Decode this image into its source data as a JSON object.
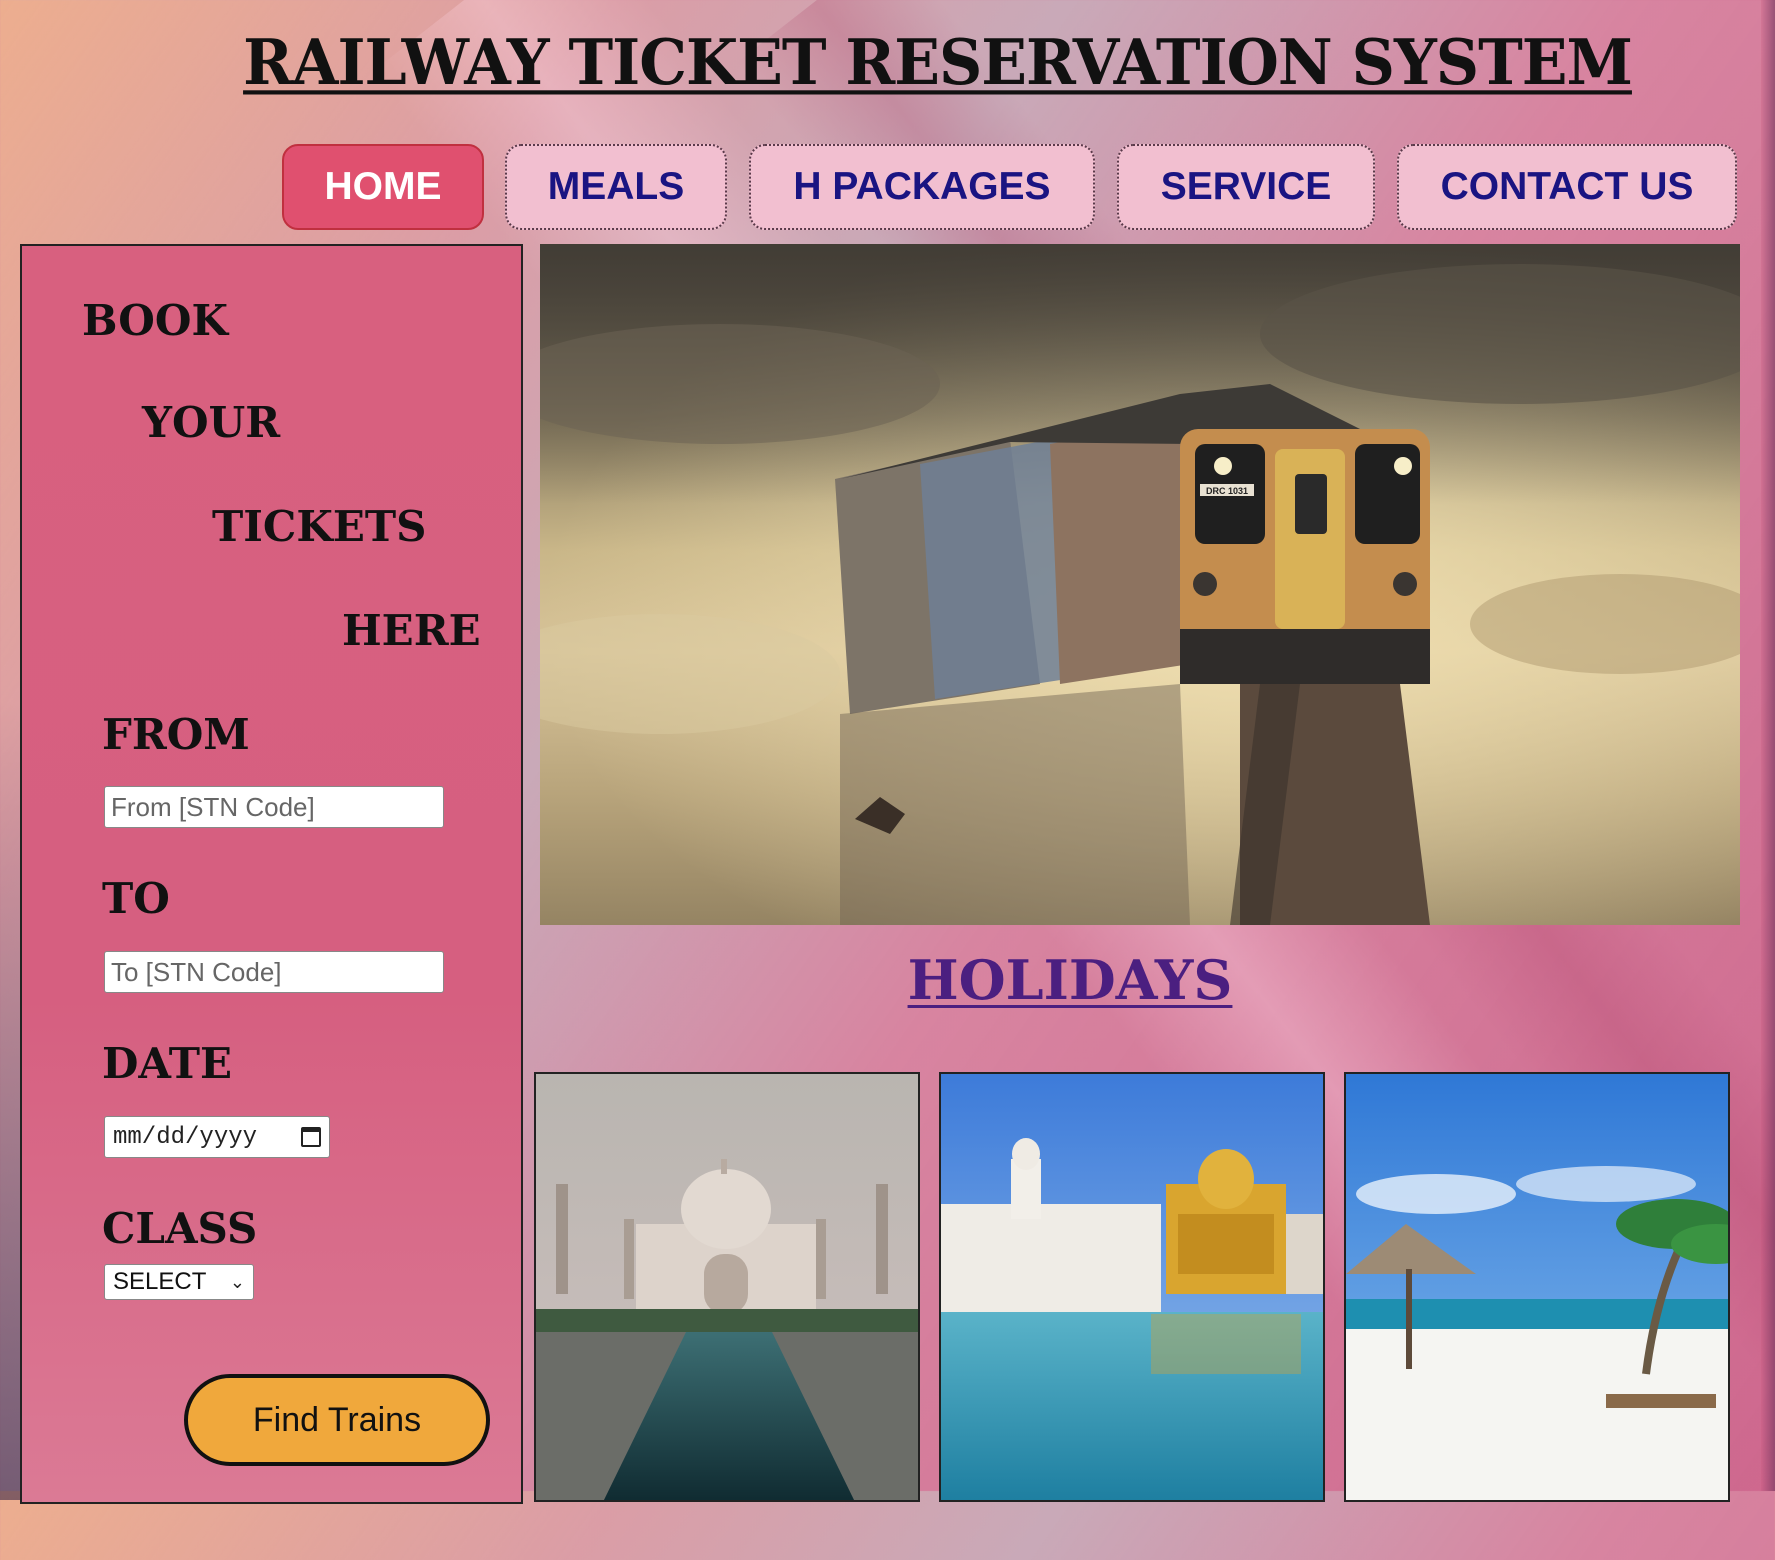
{
  "header": {
    "title": "RAILWAY TICKET RESERVATION SYSTEM"
  },
  "nav": {
    "items": [
      {
        "label": "HOME",
        "active": true
      },
      {
        "label": "MEALS",
        "active": false
      },
      {
        "label": "H PACKAGES",
        "active": false
      },
      {
        "label": "SERVICE",
        "active": false
      },
      {
        "label": "CONTACT US",
        "active": false
      }
    ]
  },
  "booking": {
    "heading_words": [
      "BOOK",
      "YOUR",
      "TICKETS",
      "HERE"
    ],
    "from_label": "FROM",
    "from_placeholder": "From [STN Code]",
    "to_label": "TO",
    "to_placeholder": "To [STN Code]",
    "date_label": "DATE",
    "date_placeholder": "mm/dd/yyyy",
    "class_label": "CLASS",
    "class_selected": "SELECT",
    "find_button": "Find Trains"
  },
  "hero": {
    "train_plate": "DRC 1031"
  },
  "holidays": {
    "title": "HOLIDAYS"
  },
  "colors": {
    "nav_active_bg": "#e0506f",
    "nav_bg": "#f2bfd0",
    "nav_text": "#1a1482",
    "panel_bg": "#d8607f",
    "find_button_bg": "#f0a83c",
    "holidays_title": "#4b1f80"
  },
  "icons": {
    "date_picker": "calendar-icon",
    "class_select": "chevron-down-icon"
  }
}
